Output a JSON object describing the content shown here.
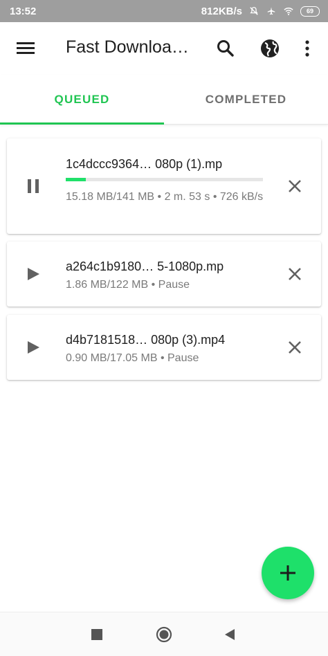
{
  "status_bar": {
    "time": "13:52",
    "network_speed": "812KB/s",
    "battery": "69",
    "icons": [
      "mute-icon",
      "airplane-icon",
      "wifi-icon",
      "battery-icon"
    ]
  },
  "app_bar": {
    "title": "Fast Downloa…",
    "icons": [
      "menu-icon",
      "search-icon",
      "globe-icon",
      "more-vert-icon"
    ]
  },
  "tabs": [
    {
      "label": "QUEUED",
      "active": true
    },
    {
      "label": "COMPLETED",
      "active": false
    }
  ],
  "downloads": [
    {
      "name": "1c4dccc9364…   080p (1).mp",
      "progress_fraction": 0.1,
      "meta": "15.18 MB/141 MB • 2 m. 53 s • 726 kB/s",
      "state_icon": "pause-icon"
    },
    {
      "name": "a264c1b9180…   5-1080p.mp",
      "meta": "1.86 MB/122 MB • Pause",
      "state_icon": "play-icon"
    },
    {
      "name": "d4b7181518…   080p (3).mp4",
      "meta": "0.90 MB/17.05 MB • Pause",
      "state_icon": "play-icon"
    }
  ],
  "fab": {
    "icon": "plus-icon"
  },
  "nav_bar": {
    "icons": [
      "recents-square-icon",
      "home-circle-icon",
      "back-triangle-icon"
    ]
  },
  "colors": {
    "accent": "#20c552",
    "fab": "#1ee06a",
    "status_bar": "#9e9e9e",
    "secondary_text": "#7a7a7a"
  }
}
